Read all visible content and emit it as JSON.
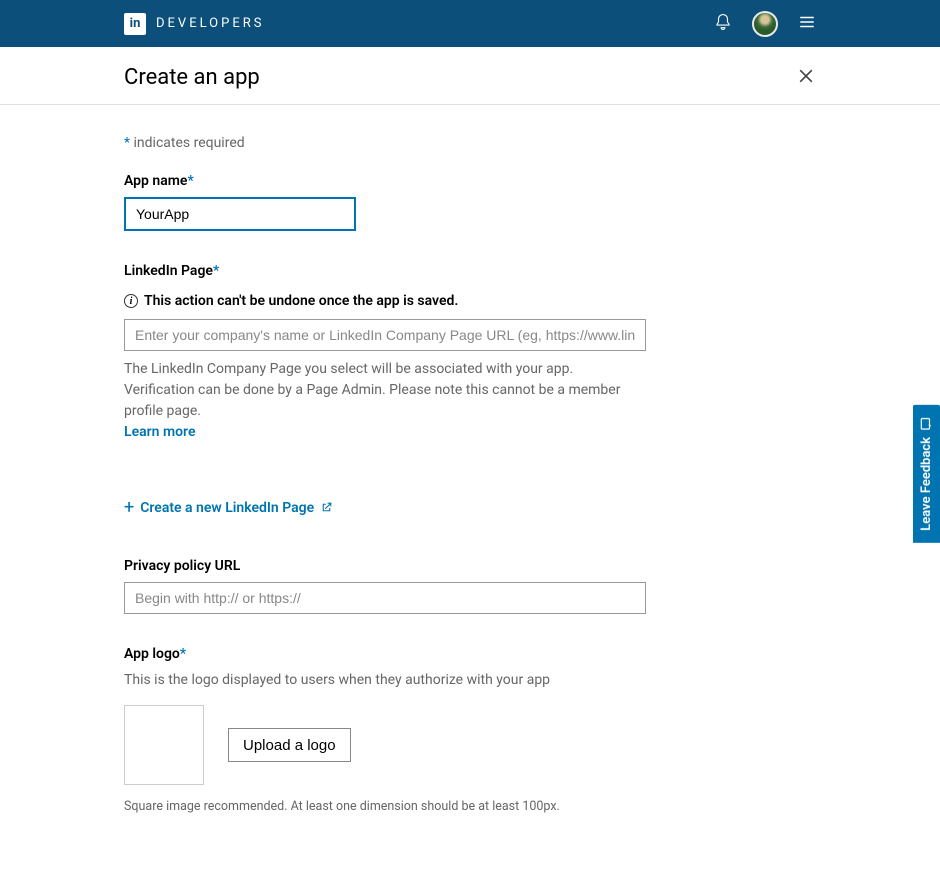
{
  "header": {
    "logo_text": "in",
    "brand": "DEVELOPERS"
  },
  "page": {
    "title": "Create an app",
    "required_note": " indicates required",
    "required_star": "*"
  },
  "fields": {
    "app_name": {
      "label": "App name",
      "value": "YourApp"
    },
    "linkedin_page": {
      "label": "LinkedIn Page",
      "warning": "This action can't be undone once the app is saved.",
      "placeholder": "Enter your company's name or LinkedIn Company Page URL (eg, https://www.link",
      "helper": "The LinkedIn Company Page you select will be associated with your app. Verification can be done by a Page Admin. Please note this cannot be a member profile page. ",
      "learn_more": "Learn more",
      "create_link": "Create a new LinkedIn Page"
    },
    "privacy": {
      "label": "Privacy policy URL",
      "placeholder": "Begin with http:// or https://"
    },
    "logo": {
      "label": "App logo",
      "desc": "This is the logo displayed to users when they authorize with your app",
      "upload_btn": "Upload a logo",
      "caption": "Square image recommended. At least one dimension should be at least 100px."
    }
  },
  "feedback": {
    "label": "Leave Feedback"
  }
}
